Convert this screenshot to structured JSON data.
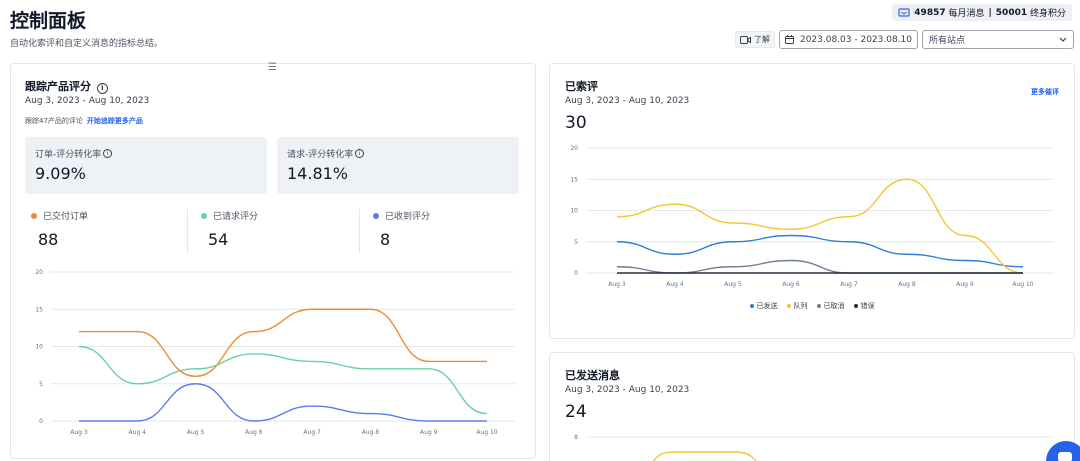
{
  "header": {
    "title": "控制面板",
    "subtitle": "自动化索评和自定义消息的指标总结。"
  },
  "credits": {
    "monthly_count": "49857",
    "monthly_label": "每月消息",
    "lifetime_count": "50001",
    "lifetime_label": "终身积分",
    "separator": "|"
  },
  "toolbar": {
    "learn_label": "了解",
    "date_range": "2023.08.03 - 2023.08.10",
    "site_select": "所有站点"
  },
  "colors": {
    "orange": "#f08a30",
    "green": "#6dd09a",
    "blue": "#5b7cf0",
    "sent_blue": "#2f7fd6",
    "queue_yellow": "#f2c733",
    "cancel_gray": "#6b7f96",
    "error_dark": "#1f2d3d"
  },
  "tracking": {
    "title": "跟踪产品评分",
    "date": "Aug 3, 2023 - Aug 10, 2023",
    "note": "跟踪47产品的评论",
    "note_link": "开始追踪更多产品",
    "order_rate_label": "订单-评分转化率",
    "order_rate_value": "9.09%",
    "request_rate_label": "请求-评分转化率",
    "request_rate_value": "14.81%",
    "stats": [
      {
        "label": "已交付订单",
        "value": "88"
      },
      {
        "label": "已请求评分",
        "value": "54"
      },
      {
        "label": "已收到评分",
        "value": "8"
      }
    ]
  },
  "reviewed": {
    "title": "已索评",
    "date": "Aug 3, 2023 - Aug 10, 2023",
    "more_link": "更多催评",
    "total": "30",
    "legend": [
      "已发送",
      "队列",
      "已取消",
      "错误"
    ]
  },
  "messages": {
    "title": "已发送消息",
    "date": "Aug 3, 2023 - Aug 10, 2023",
    "total": "24"
  },
  "chart_data": [
    {
      "type": "line",
      "categories": [
        "Aug 3",
        "Aug 4",
        "Aug 5",
        "Aug 6",
        "Aug 7",
        "Aug 8",
        "Aug 9",
        "Aug 10"
      ],
      "ylim": [
        0,
        20
      ],
      "yticks": [
        0,
        5,
        10,
        15,
        20
      ],
      "grid": true,
      "series": [
        {
          "name": "已交付订单",
          "values": [
            12,
            12,
            6,
            12,
            15,
            15,
            8,
            8
          ]
        },
        {
          "name": "已请求评分",
          "values": [
            10,
            5,
            7,
            9,
            8,
            7,
            7,
            1
          ]
        },
        {
          "name": "已收到评分",
          "values": [
            0,
            0,
            5,
            0,
            2,
            1,
            0,
            0
          ]
        }
      ]
    },
    {
      "type": "line",
      "categories": [
        "Aug 3",
        "Aug 4",
        "Aug 5",
        "Aug 6",
        "Aug 7",
        "Aug 8",
        "Aug 9",
        "Aug 10"
      ],
      "ylim": [
        0,
        20
      ],
      "yticks": [
        0,
        5,
        10,
        15,
        20
      ],
      "grid": true,
      "legend_position": "bottom",
      "series": [
        {
          "name": "已发送",
          "values": [
            5,
            3,
            5,
            6,
            5,
            3,
            2,
            1
          ]
        },
        {
          "name": "队列",
          "values": [
            9,
            11,
            8,
            7,
            9,
            15,
            6,
            0
          ]
        },
        {
          "name": "已取消",
          "values": [
            1,
            0,
            1,
            2,
            0,
            0,
            0,
            0
          ]
        },
        {
          "name": "错误",
          "values": [
            0,
            0,
            0,
            0,
            0,
            0,
            0,
            0
          ]
        }
      ]
    },
    {
      "type": "line",
      "yticks": [
        8
      ],
      "grid": true,
      "series": []
    }
  ]
}
